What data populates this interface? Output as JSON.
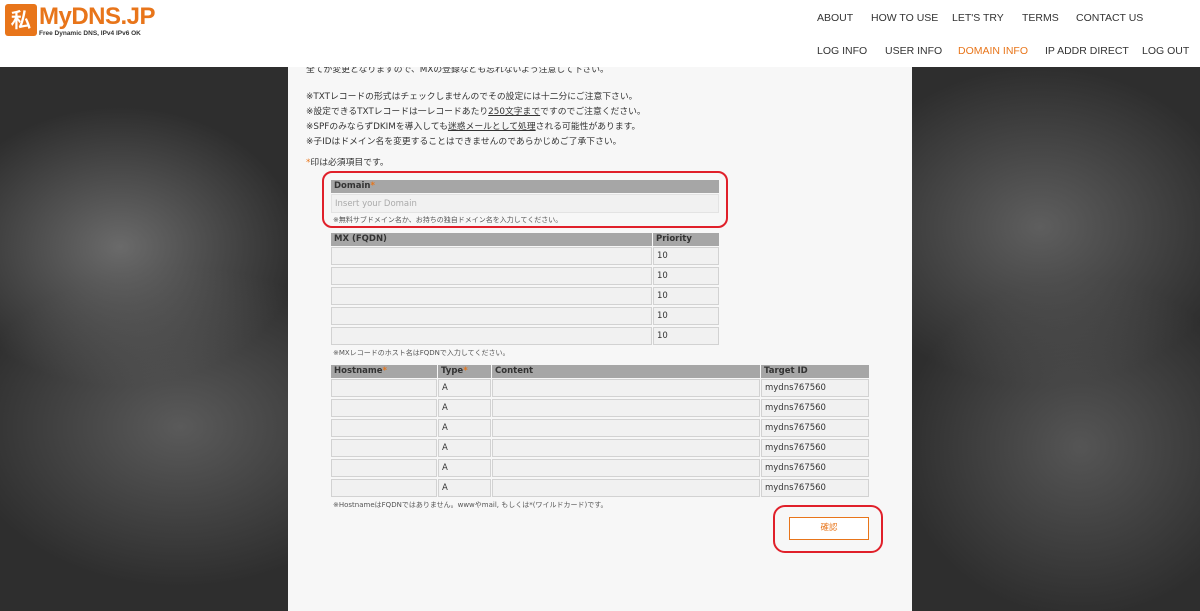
{
  "logo": {
    "mark": "私",
    "name": "MyDNS.JP",
    "tagline": "Free Dynamic DNS, IPv4 IPv6 OK"
  },
  "nav": {
    "top": [
      "ABOUT",
      "HOW TO USE",
      "LET'S TRY",
      "TERMS",
      "CONTACT US"
    ],
    "bottom": [
      "LOG INFO",
      "USER INFO",
      "DOMAIN INFO",
      "IP ADDR DIRECT",
      "LOG OUT"
    ],
    "active": "DOMAIN INFO"
  },
  "notes": {
    "cut_top": "全てが変更となりますので、MXの登録なども忘れないよう注意して下さい。",
    "n1": "※TXTレコードの形式はチェックしませんのでその設定には十二分にご注意下さい。",
    "n2a": "※設定できるTXTレコードは一レコードあたり",
    "n2b": "250文字まで",
    "n2c": "ですのでご注意ください。",
    "n3a": "※SPFのみならずDKIMを導入しても",
    "n3b": "迷惑メールとして処理",
    "n3c": "される可能性があります。",
    "n4": "※子IDはドメイン名を変更することはできませんのであらかじめご了承下さい。",
    "required_mark": "*",
    "required_text": "印は必須項目です。"
  },
  "domain": {
    "label": "Domain",
    "placeholder": "Insert your Domain",
    "hint": "※無料サブドメイン名か、お持ちの独自ドメイン名を入力してください。"
  },
  "mx": {
    "col_fqdn": "MX (FQDN)",
    "col_priority": "Priority",
    "rows": [
      {
        "fqdn": "",
        "priority": "10"
      },
      {
        "fqdn": "",
        "priority": "10"
      },
      {
        "fqdn": "",
        "priority": "10"
      },
      {
        "fqdn": "",
        "priority": "10"
      },
      {
        "fqdn": "",
        "priority": "10"
      }
    ],
    "hint": "※MXレコードのホスト名はFQDNで入力してください。"
  },
  "records": {
    "col_hostname": "Hostname",
    "col_type": "Type",
    "col_content": "Content",
    "col_target": "Target ID",
    "rows": [
      {
        "hostname": "",
        "type": "A",
        "content": "",
        "target": "mydns767560"
      },
      {
        "hostname": "",
        "type": "A",
        "content": "",
        "target": "mydns767560"
      },
      {
        "hostname": "",
        "type": "A",
        "content": "",
        "target": "mydns767560"
      },
      {
        "hostname": "",
        "type": "A",
        "content": "",
        "target": "mydns767560"
      },
      {
        "hostname": "",
        "type": "A",
        "content": "",
        "target": "mydns767560"
      },
      {
        "hostname": "",
        "type": "A",
        "content": "",
        "target": "mydns767560"
      }
    ],
    "hint": "※HostnameはFQDNではありません。wwwやmail, もしくは*(ワイルドカード)です。"
  },
  "confirm_label": "確認",
  "colors": {
    "accent": "#e8751a",
    "annotation": "#e0202a"
  }
}
